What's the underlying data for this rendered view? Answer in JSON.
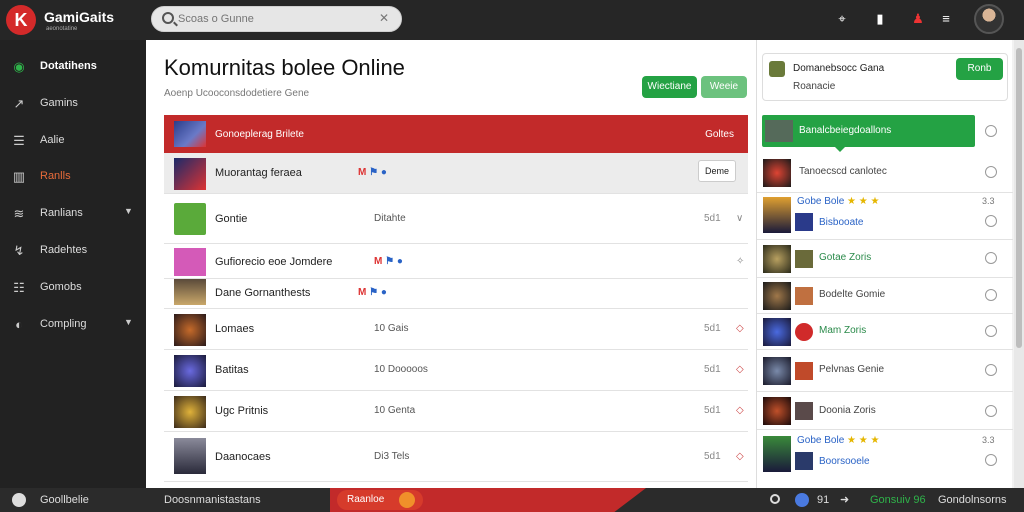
{
  "brand": {
    "logo_letter": "K",
    "name": "GamiGaits",
    "subtitle": "aeonotatine"
  },
  "search": {
    "placeholder": "Scoas o Gunne",
    "clear": "✕"
  },
  "topbar_icons": [
    "game-controller-icon",
    "bag-icon",
    "user-icon",
    "notification-icon",
    "avatar"
  ],
  "sidebar": {
    "items": [
      {
        "icon": "shield-icon",
        "label": "Dotatihens"
      },
      {
        "icon": "chart-icon",
        "label": "Gamins"
      },
      {
        "icon": "list-icon",
        "label": "Aalie"
      },
      {
        "icon": "store-icon",
        "label": "Ranlls"
      },
      {
        "icon": "stack-icon",
        "label": "Ranlians"
      },
      {
        "icon": "badge-icon",
        "label": "Radehtes"
      },
      {
        "icon": "list-icon",
        "label": "Gomobs"
      },
      {
        "icon": "compass-icon",
        "label": "Compling"
      }
    ],
    "footer": "Goollbelie"
  },
  "main": {
    "title": "Komurnitas bolee Online",
    "subtitle": "Aoenp Ucooconsdodetiere Gene",
    "buttons": [
      "Wiectiane",
      "Weeie"
    ],
    "table_header": {
      "title": "Gonoeplerag Brilete",
      "right": "Goltes"
    },
    "rows": [
      {
        "name": "Muorantag feraea",
        "meta": "M ⚑ ●",
        "action": "Deme"
      },
      {
        "name": "Gontie",
        "meta": "Ditahte",
        "num": "5d1"
      },
      {
        "name": "Gufiorecio eoe Jomdere",
        "meta": "M ⚑ ●"
      },
      {
        "name": "Dane Gornanthests",
        "meta": "M ⚑ ●"
      },
      {
        "name": "Lomaes",
        "meta": "10 Gais",
        "num": "5d1"
      },
      {
        "name": "Batitas",
        "meta": "10 Dooooos",
        "num": "5d1"
      },
      {
        "name": "Ugc Pritnis",
        "meta": "10 Genta",
        "num": "5d1"
      },
      {
        "name": "Daanocaes",
        "meta": "Di3 Tels",
        "num": "5d1"
      }
    ]
  },
  "right": {
    "card": {
      "title": "Domanebsocc Gana",
      "sub": "Roanacie",
      "button": "Ronb"
    },
    "header": "Banalcbeiegdoallons",
    "rows": [
      {
        "text": "Tanoecscd canlotec"
      },
      {
        "text": "Gobe Bole",
        "stars": "★ ★ ★",
        "line2": "Bisbooate",
        "num": "3.3"
      },
      {
        "text": "Gotae Zoris"
      },
      {
        "text": "Bodelte Gomie"
      },
      {
        "text": "Mam Zoris"
      },
      {
        "text": "Pelvnas Genie"
      },
      {
        "text": "Doonia Zoris"
      },
      {
        "text": "Gobe Bole",
        "stars": "★ ★ ★",
        "line2": "Boorsooele",
        "num": "3.3"
      }
    ]
  },
  "bottombar": {
    "left": "Goollbelie",
    "center": "Doosnmanistastans",
    "pill": "Raanloe",
    "right_items": [
      "91",
      "Gonsuiv 96",
      "Gondolnsorns"
    ]
  },
  "colors": {
    "accent_red": "#c22a2a",
    "accent_green": "#24a244",
    "sidebar_bg": "#222222"
  }
}
